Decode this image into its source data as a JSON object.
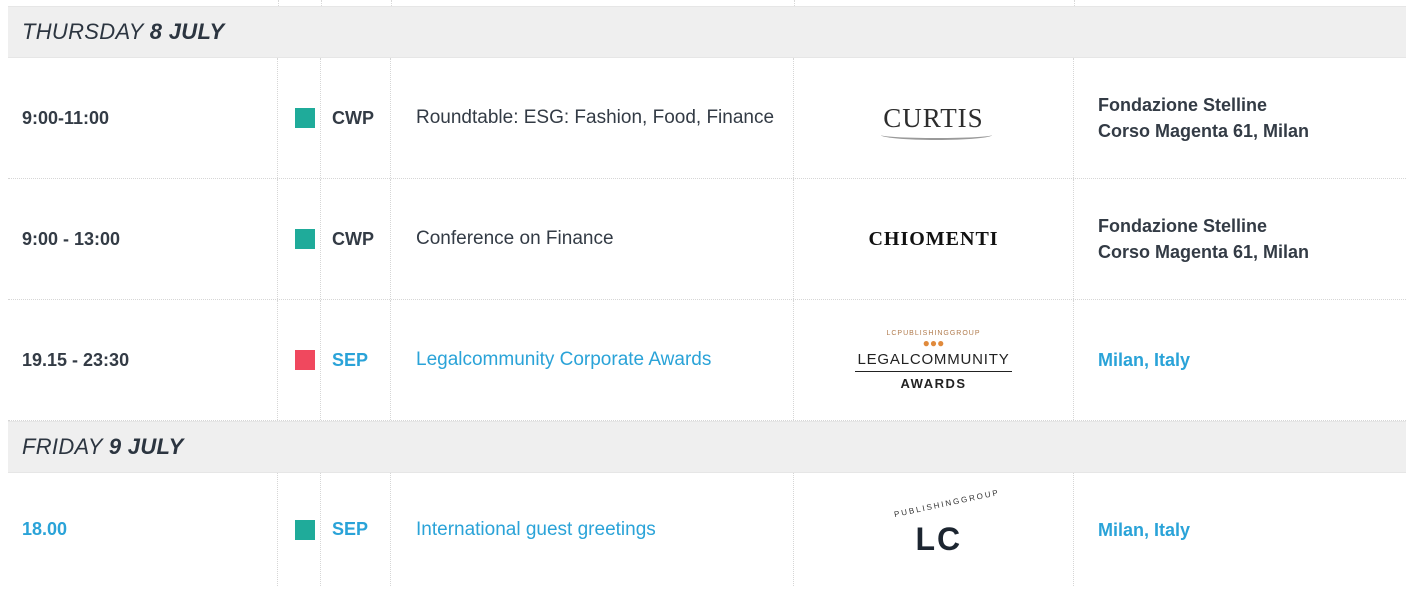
{
  "colors": {
    "teal": "#1fab9a",
    "red": "#f0485e",
    "link": "#2aa3d8",
    "text": "#333b45"
  },
  "days": [
    {
      "day_prefix": "THURSDAY",
      "date": "8 JULY",
      "events": [
        {
          "time": "9:00-11:00",
          "color": "#1fab9a",
          "code": "CWP",
          "title": "Roundtable:  ESG: Fashion, Food, Finance",
          "logo": "CURTIS",
          "venue_line1": "Fondazione Stelline",
          "venue_line2": "Corso Magenta 61, Milan",
          "is_link": false
        },
        {
          "time": "9:00 - 13:00",
          "color": "#1fab9a",
          "code": "CWP",
          "title": "Conference on Finance",
          "logo": "CHIOMENTI",
          "venue_line1": "Fondazione Stelline",
          "venue_line2": "Corso Magenta 61, Milan",
          "is_link": false
        },
        {
          "time": "19.15 - 23:30",
          "color": "#f0485e",
          "code": "SEP",
          "title": "Legalcommunity Corporate Awards",
          "logo_arc": "LCPUBLISHINGGROUP",
          "logo_main": "LEGALCOMMUNITY",
          "logo_sub": "AWARDS",
          "venue_line1": "Milan, Italy",
          "is_link": true
        }
      ]
    },
    {
      "day_prefix": "FRIDAY",
      "date": "9 JULY",
      "events": [
        {
          "time": "18.00",
          "color": "#1fab9a",
          "code": "SEP",
          "title": "International guest greetings",
          "logo_arc": "PUBLISHINGGROUP",
          "logo_main": "LC",
          "venue_line1": "Milan, Italy",
          "is_link": true
        }
      ]
    }
  ]
}
